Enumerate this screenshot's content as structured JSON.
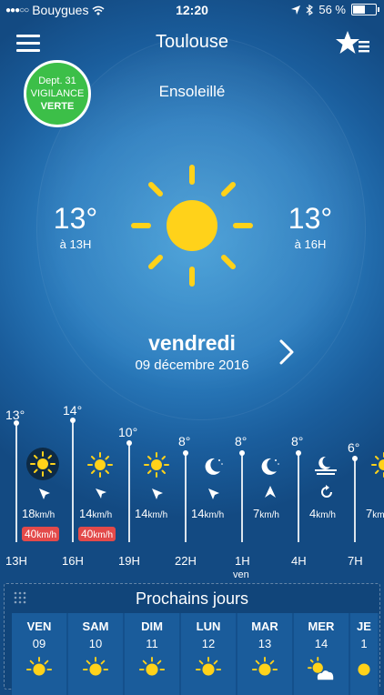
{
  "status": {
    "carrier": "Bouygues",
    "time": "12:20",
    "battery": "56 %"
  },
  "header": {
    "city": "Toulouse"
  },
  "vigilance": {
    "line1": "Dept. 31",
    "line2": "VIGILANCE",
    "line3": "VERTE",
    "color": "#3cbf48"
  },
  "current": {
    "condition": "Ensoleillé",
    "left_temp": "13°",
    "left_time": "à 13H",
    "right_temp": "13°",
    "right_time": "à 16H",
    "day": "vendredi",
    "date": "09 décembre 2016"
  },
  "hourly": [
    {
      "temp": "13°",
      "icon": "sun-icon",
      "wind": "18",
      "wind_unit": "km/h",
      "gust": "40",
      "gust_unit": "km/h",
      "hour": "13H",
      "sub": ""
    },
    {
      "temp": "14°",
      "icon": "sun-icon",
      "wind": "14",
      "wind_unit": "km/h",
      "gust": "40",
      "gust_unit": "km/h",
      "hour": "16H",
      "sub": ""
    },
    {
      "temp": "10°",
      "icon": "sun-icon",
      "wind": "14",
      "wind_unit": "km/h",
      "gust": "",
      "gust_unit": "",
      "hour": "19H",
      "sub": ""
    },
    {
      "temp": "8°",
      "icon": "moon-icon",
      "wind": "14",
      "wind_unit": "km/h",
      "gust": "",
      "gust_unit": "",
      "hour": "22H",
      "sub": ""
    },
    {
      "temp": "8°",
      "icon": "moon-icon",
      "wind": "7",
      "wind_unit": "km/h",
      "gust": "",
      "gust_unit": "",
      "hour": "1H",
      "sub": "ven"
    },
    {
      "temp": "8°",
      "icon": "fog-moon-icon",
      "wind": "4",
      "wind_unit": "km/h",
      "gust": "",
      "gust_unit": "",
      "hour": "4H",
      "sub": ""
    },
    {
      "temp": "6°",
      "icon": "sun-icon",
      "wind": "7",
      "wind_unit": "km/h",
      "gust": "",
      "gust_unit": "",
      "hour": "7H",
      "sub": ""
    }
  ],
  "next_days": {
    "title": "Prochains jours",
    "days": [
      {
        "name": "VEN",
        "date": "09",
        "icon": "sun-icon"
      },
      {
        "name": "SAM",
        "date": "10",
        "icon": "sun-icon"
      },
      {
        "name": "DIM",
        "date": "11",
        "icon": "sun-icon"
      },
      {
        "name": "LUN",
        "date": "12",
        "icon": "sun-icon"
      },
      {
        "name": "MAR",
        "date": "13",
        "icon": "sun-icon"
      },
      {
        "name": "MER",
        "date": "14",
        "icon": "sun-cloud-icon"
      },
      {
        "name": "JE",
        "date": "1",
        "icon": "sun-icon"
      }
    ]
  },
  "colors": {
    "sun": "#ffd21a",
    "gust_bg": "#e34a4a",
    "background": "#2b7dbf"
  }
}
